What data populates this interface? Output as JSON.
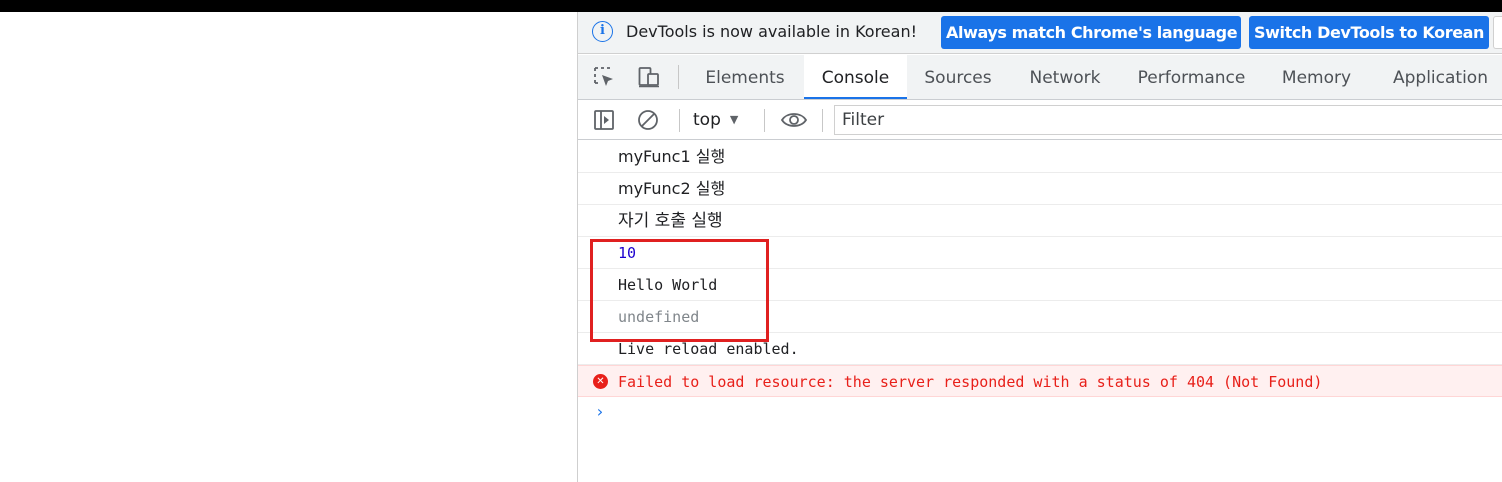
{
  "infobar": {
    "icon": "info-icon",
    "message": "DevTools is now available in Korean!",
    "match_button": "Always match Chrome's language",
    "switch_button": "Switch DevTools to Korean",
    "accent_color": "#1a73e8"
  },
  "toolbar_icons": [
    "inspect-element-icon",
    "device-toolbar-icon"
  ],
  "tabs": [
    "Elements",
    "Console",
    "Sources",
    "Network",
    "Performance",
    "Memory",
    "Application"
  ],
  "active_tab": "Console",
  "console_toolbar": {
    "sidebar_icon": "show-sidebar-icon",
    "clear_icon": "clear-console-icon",
    "context": "top",
    "eye_icon": "live-expression-eye-icon",
    "filter_placeholder": "Filter"
  },
  "messages": [
    {
      "text": "myFunc1 실행",
      "kind": "log"
    },
    {
      "text": "myFunc2 실행",
      "kind": "log"
    },
    {
      "text": "자기 호출 실행",
      "kind": "log"
    },
    {
      "text": "10",
      "kind": "number"
    },
    {
      "text": "Hello World",
      "kind": "log"
    },
    {
      "text": "undefined",
      "kind": "undefined"
    },
    {
      "text": "Live reload enabled.",
      "kind": "log"
    },
    {
      "text": "Failed to load resource: the server responded with a status of 404 (Not Found)",
      "kind": "error",
      "icon": "error-icon"
    }
  ],
  "prompt_symbol": "›",
  "highlight_color": "#e02020"
}
